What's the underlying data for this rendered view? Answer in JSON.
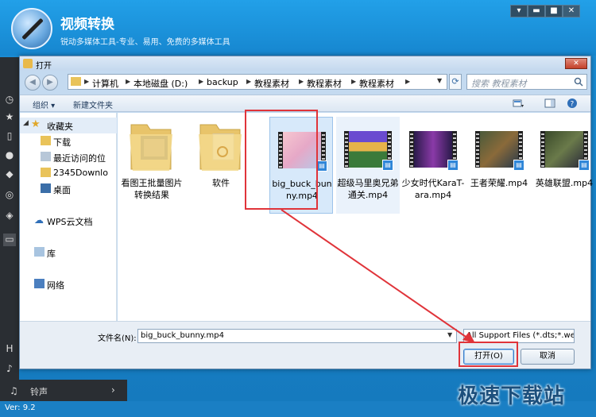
{
  "app": {
    "title": "视频转换",
    "subtitle": "锐动多媒体工具-专业、易用、免费的多媒体工具",
    "ringtone_label": "铃声",
    "version": "Ver: 9.2",
    "watermark": "极速下载站",
    "window_buttons": [
      "▾",
      "▬",
      "■",
      "✕"
    ]
  },
  "dialog": {
    "title": "打开",
    "breadcrumb": [
      "计算机",
      "本地磁盘 (D:)",
      "backup",
      "教程素材",
      "教程素材",
      "教程素材"
    ],
    "search_placeholder": "搜索 教程素材",
    "toolbar": {
      "organize": "组织 ▾",
      "new_folder": "新建文件夹"
    },
    "nav": {
      "favorites_header": "收藏夹",
      "favorites": [
        "下载",
        "最近访问的位",
        "2345Downlo",
        "桌面"
      ],
      "wps": "WPS云文档",
      "library": "库",
      "network": "网络"
    },
    "files": [
      {
        "name": "看图王批量图片转换结果",
        "type": "folder"
      },
      {
        "name": "软件",
        "type": "folder"
      },
      {
        "name": "big_buck_bunny.mp4",
        "type": "video",
        "selected": true
      },
      {
        "name": "超级马里奥兄弟通关.mp4",
        "type": "video"
      },
      {
        "name": "少女时代KaraT-ara.mp4",
        "type": "video"
      },
      {
        "name": "王者荣耀.mp4",
        "type": "video"
      },
      {
        "name": "英雄联盟.mp4",
        "type": "video"
      }
    ],
    "filename_label": "文件名(N):",
    "filename_value": "big_buck_bunny.mp4",
    "filter": "All Support Files (*.dts;*.web",
    "open_button": "打开(O)",
    "cancel_button": "取消"
  },
  "colors": {
    "accent": "#1a8fd8",
    "highlight": "#e0343a"
  }
}
